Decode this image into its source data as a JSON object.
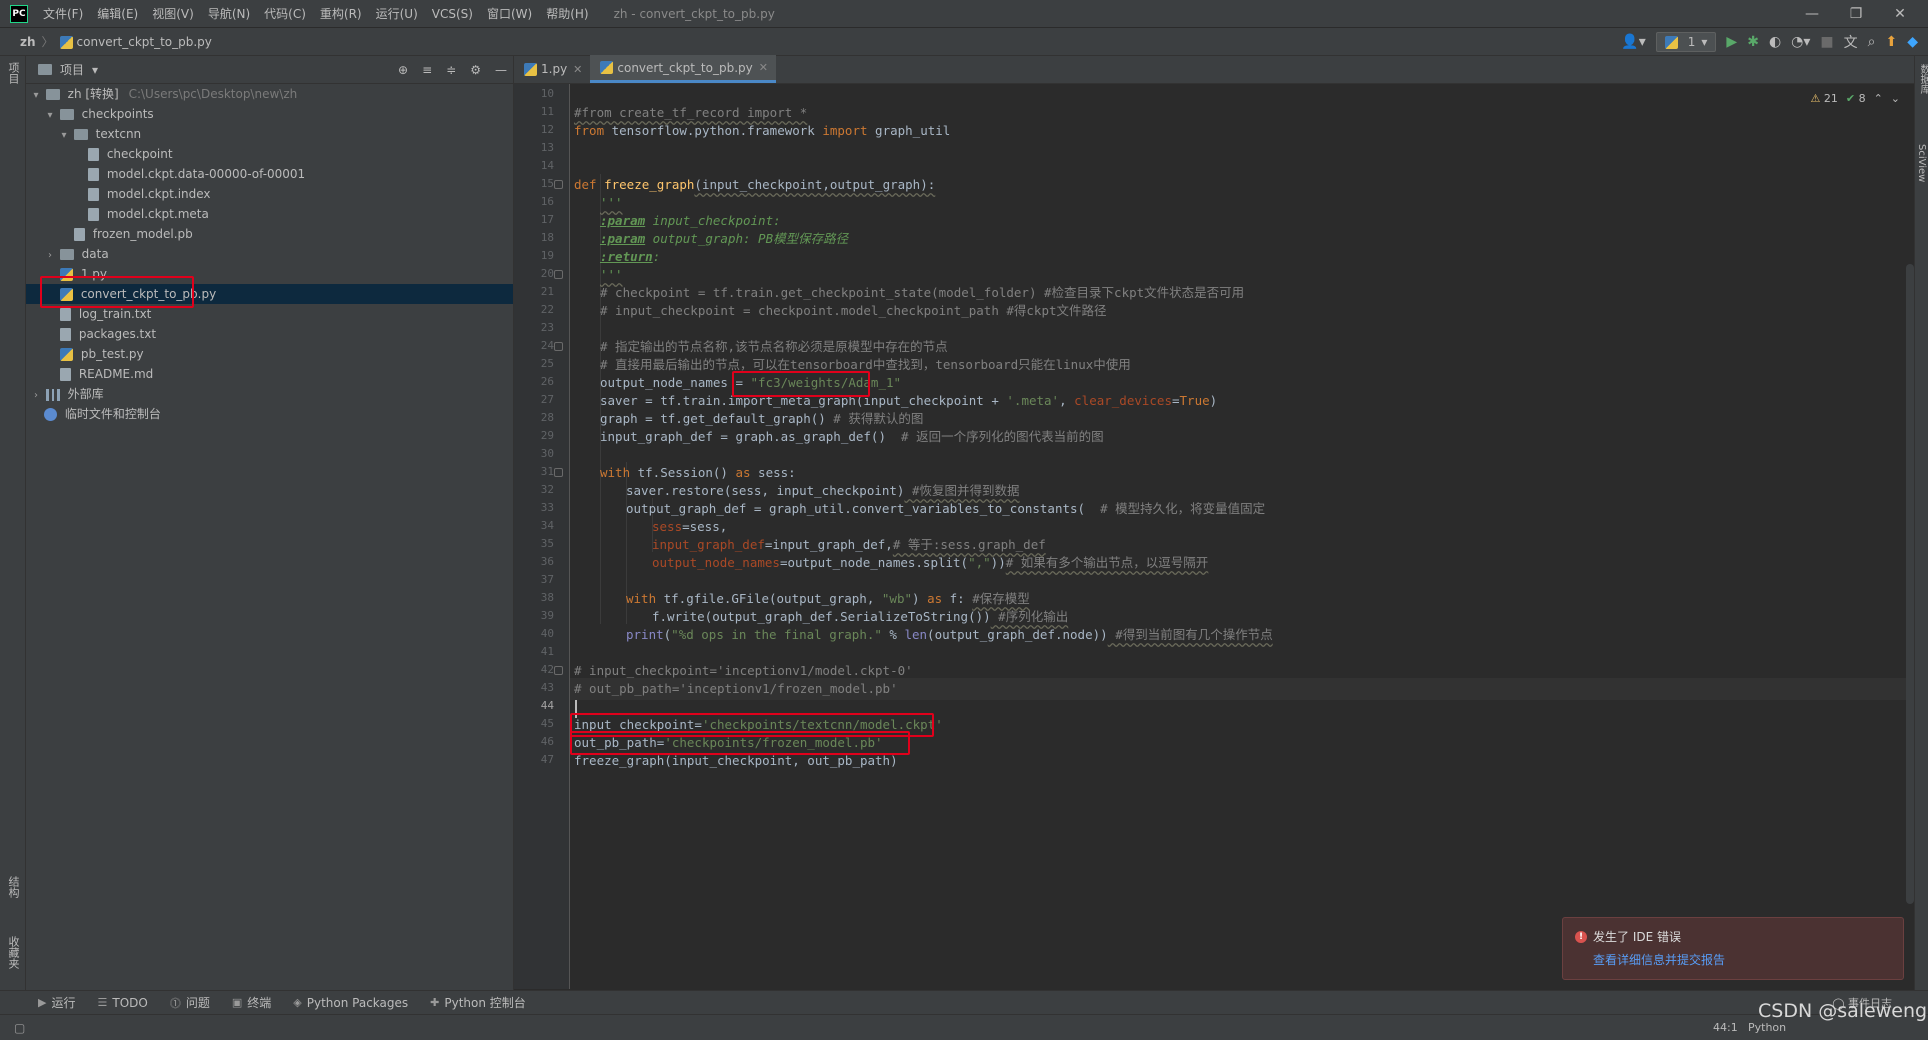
{
  "menubar": {
    "logo": "PC",
    "items": [
      "文件(F)",
      "编辑(E)",
      "视图(V)",
      "导航(N)",
      "代码(C)",
      "重构(R)",
      "运行(U)",
      "VCS(S)",
      "窗口(W)",
      "帮助(H)"
    ],
    "window_title": "zh - convert_ckpt_to_pb.py"
  },
  "navbar": {
    "project": "zh",
    "file": "convert_ckpt_to_pb.py",
    "run_config": "1"
  },
  "left_stripe": {
    "project_label": "项目",
    "structure_label": "结构",
    "favorites_label": "收藏夹"
  },
  "right_stripe": {
    "database_label": "数据库",
    "sciview_label": "SciView"
  },
  "project_panel": {
    "title": "项目",
    "tree": {
      "root": {
        "name": "zh [转换]",
        "path": "C:\\Users\\pc\\Desktop\\new\\zh"
      },
      "checkpoints": "checkpoints",
      "textcnn": "textcnn",
      "textcnn_files": [
        "checkpoint",
        "model.ckpt.data-00000-of-00001",
        "model.ckpt.index",
        "model.ckpt.meta"
      ],
      "frozen_model": "frozen_model.pb",
      "data": "data",
      "root_files": [
        "1.py",
        "convert_ckpt_to_pb.py",
        "log_train.txt",
        "packages.txt",
        "pb_test.py",
        "README.md"
      ],
      "external_libs": "外部库",
      "scratches": "临时文件和控制台"
    }
  },
  "editor": {
    "tabs": [
      {
        "label": "1.py"
      },
      {
        "label": "convert_ckpt_to_pb.py"
      }
    ],
    "inspections": {
      "warnings": "21",
      "weak_warnings": "8"
    },
    "current_line": "44",
    "line_numbers": [
      "10",
      "11",
      "12",
      "13",
      "14",
      "15",
      "16",
      "17",
      "18",
      "19",
      "20",
      "21",
      "22",
      "23",
      "24",
      "25",
      "26",
      "27",
      "28",
      "29",
      "30",
      "31",
      "32",
      "33",
      "34",
      "35",
      "36",
      "37",
      "38",
      "39",
      "40",
      "41",
      "42",
      "43",
      "44",
      "45",
      "46",
      "47"
    ],
    "code": {
      "l11": "#from create_tf_record import *",
      "l12_kw1": "from",
      "l12_mod": " tensorflow.python.framework ",
      "l12_kw2": "import",
      "l12_name": " graph_util",
      "l15_kw": "def",
      "l15_fn": "freeze_graph",
      "l15_args": "(input_checkpoint,output_graph):",
      "l16": "'''",
      "l17_tag": ":param",
      "l17_rest": " input_checkpoint:",
      "l18_tag": ":param",
      "l18_rest": " output_graph: PB模型保存路径",
      "l19_tag": ":return",
      "l19_rest": ":",
      "l20": "'''",
      "l21": "# checkpoint = tf.train.get_checkpoint_state(model_folder) #检查目录下ckpt文件状态是否可用",
      "l22": "# input_checkpoint = checkpoint.model_checkpoint_path #得ckpt文件路径",
      "l24": "# 指定输出的节点名称,该节点名称必须是原模型中存在的节点",
      "l25": "# 直接用最后输出的节点，可以在tensorboard中查找到，tensorboard只能在linux中使用",
      "l26_a": "output_node_names = ",
      "l26_str": "\"fc3/weights/Adam_1\"",
      "l27_a": "saver = tf.train.import_meta_graph(input_checkpoint + ",
      "l27_str": "'.meta'",
      "l27_b": ", ",
      "l27_param": "clear_devices",
      "l27_c": "=",
      "l27_kw": "True",
      "l27_d": ")",
      "l28_a": "graph = tf.get_default_graph()",
      "l28_cmt": " # 获得默认的图",
      "l29_a": "input_graph_def = graph.as_graph_def()  ",
      "l29_cmt": "# 返回一个序列化的图代表当前的图",
      "l31_kw": "with",
      "l31_a": " tf.Session() ",
      "l31_kw2": "as",
      "l31_b": " sess:",
      "l32_a": "saver.restore(sess, input_checkpoint)",
      "l32_cmt": " #恢复图并得到数据",
      "l33_a": "output_graph_def = graph_util.convert_variables_to_constants(  ",
      "l33_cmt": "# 模型持久化，将变量值固定",
      "l34_param": "sess",
      "l34_a": "=sess,",
      "l35_param": "input_graph_def",
      "l35_a": "=input_graph_def,",
      "l35_cmt": "# 等于:sess.graph_def",
      "l36_param": "output_node_names",
      "l36_a": "=output_node_names.split(",
      "l36_str": "\",\"",
      "l36_b": "))",
      "l36_cmt": "# 如果有多个输出节点，以逗号隔开",
      "l38_kw": "with",
      "l38_a": " tf.gfile.GFile(output_graph, ",
      "l38_str": "\"wb\"",
      "l38_b": ") ",
      "l38_kw2": "as",
      "l38_c": " f: ",
      "l38_cmt": "#保存模型",
      "l39_a": "f.write(output_graph_def.SerializeToString())",
      "l39_cmt": " #序列化输出",
      "l40_builtin": "print",
      "l40_a": "(",
      "l40_str": "\"%d ops in the final graph.\"",
      "l40_b": " % ",
      "l40_builtin2": "len",
      "l40_c": "(output_graph_def.node))",
      "l40_cmt": " #得到当前图有几个操作节点",
      "l42": "# input_checkpoint='inceptionv1/model.ckpt-0'",
      "l43": "# out_pb_path='inceptionv1/frozen_model.pb'",
      "l45_a": "input_checkpoint=",
      "l45_str": "'checkpoints/textcnn/model.ckpt'",
      "l46_a": "out_pb_path=",
      "l46_str": "'checkpoints/frozen_model.pb'",
      "l47": "freeze_graph(input_checkpoint, out_pb_path)"
    }
  },
  "notification": {
    "title": "发生了 IDE 错误",
    "link": "查看详细信息并提交报告"
  },
  "bottom_tabs": [
    "运行",
    "TODO",
    "问题",
    "终端",
    "Python Packages",
    "Python 控制台"
  ],
  "event_log": "事件日志",
  "status": {
    "position": "44:1",
    "interpreter": "Python"
  },
  "watermark": "CSDN @saleweng",
  "colors": {
    "accent": "#4a88c7",
    "highlight_box": "#e0001b",
    "selected_row": "#0d293e"
  }
}
